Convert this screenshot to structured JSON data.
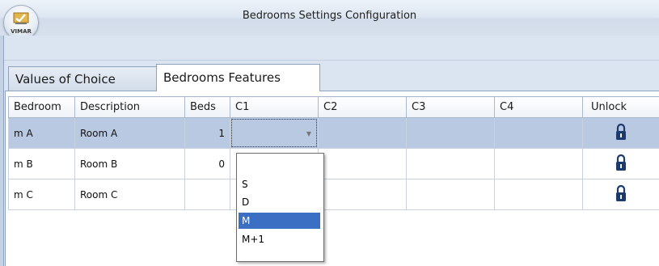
{
  "window": {
    "title": "Bedrooms Settings Configuration",
    "logo_text": "VIMAR"
  },
  "tabs": [
    {
      "label": "Values of Choice",
      "active": false
    },
    {
      "label": "Bedrooms Features",
      "active": true
    }
  ],
  "table": {
    "columns": [
      "Bedroom",
      "Description",
      "Beds",
      "C1",
      "C2",
      "C3",
      "C4",
      "Unlock"
    ],
    "rows": [
      {
        "bedroom": "m A",
        "description": "Room A",
        "beds": "1",
        "c1": "",
        "c2": "",
        "c3": "",
        "c4": "",
        "unlock_icon": "unlock-icon",
        "selected": true
      },
      {
        "bedroom": "m B",
        "description": "Room B",
        "beds": "0",
        "c1": "",
        "c2": "",
        "c3": "",
        "c4": "",
        "unlock_icon": "unlock-icon",
        "selected": false
      },
      {
        "bedroom": "m C",
        "description": "Room C",
        "beds": "",
        "c1": "",
        "c2": "",
        "c3": "",
        "c4": "",
        "unlock_icon": "unlock-icon",
        "selected": false
      }
    ]
  },
  "dropdown": {
    "options": [
      "",
      "S",
      "D",
      "M",
      "M+1"
    ],
    "highlighted": "M"
  },
  "colors": {
    "selected_row": "#bac9e2",
    "highlight": "#3a6fc3",
    "lock": "#1c3a6e"
  }
}
